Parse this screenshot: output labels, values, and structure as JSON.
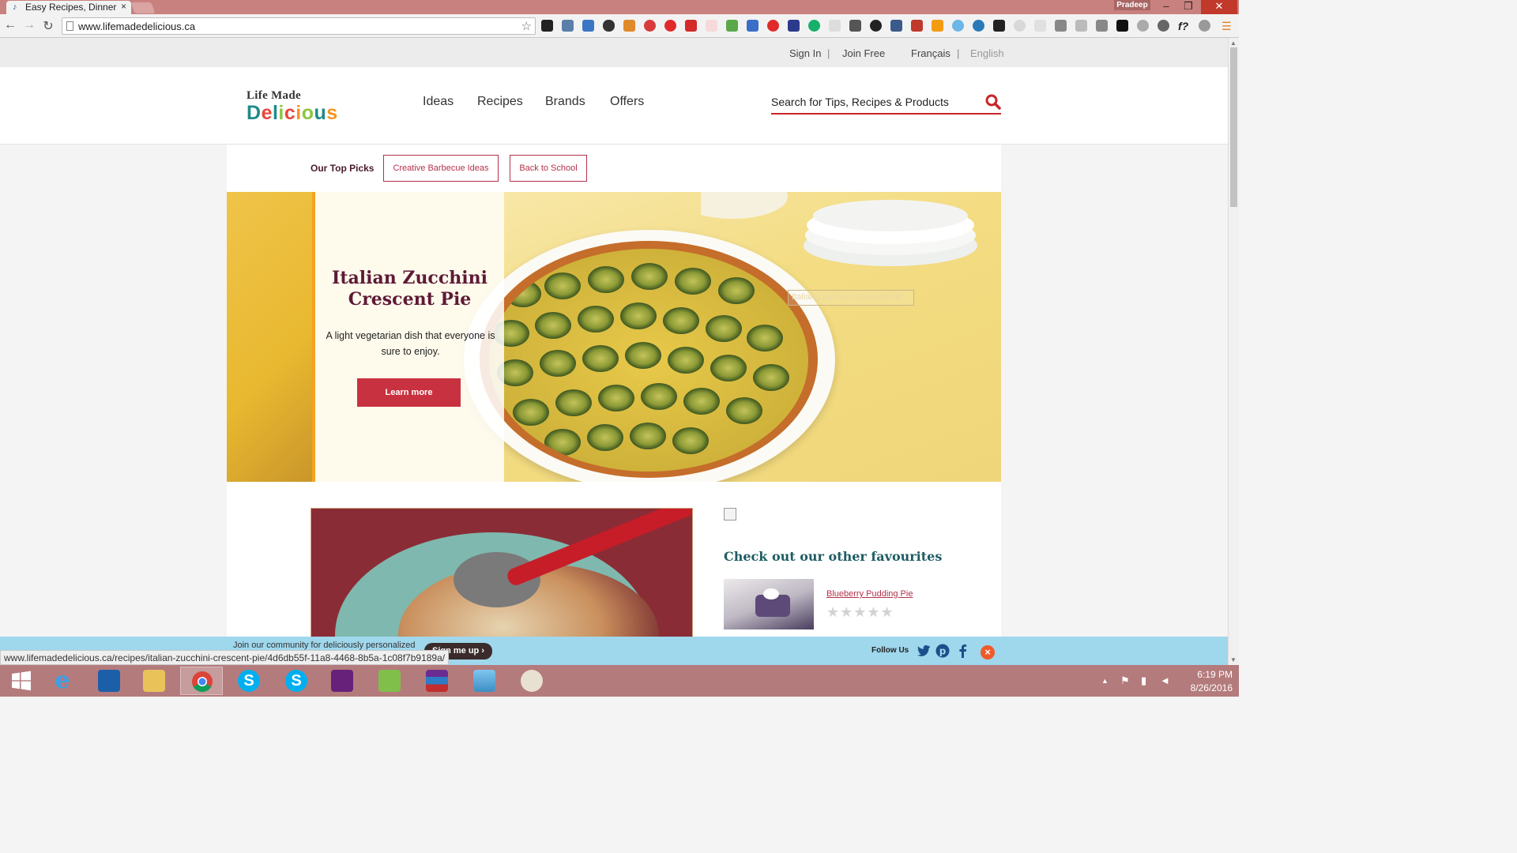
{
  "browser": {
    "tab_title": "Easy Recipes, Dinner",
    "tab_close": "×",
    "favicon": "♪",
    "profile_name": "Pradeep",
    "url": "www.lifemadedelicious.ca",
    "status_url": "www.lifemadedelicious.ca/recipes/italian-zucchini-crescent-pie/4d6db55f-11a8-4468-8b5a-1c08f7b9189a/",
    "window_controls": [
      "–",
      "❐",
      "✕"
    ],
    "nav_icons": [
      "←",
      "→",
      "↻"
    ]
  },
  "utility": {
    "sign_in": "Sign In",
    "sep": "|",
    "join_free": "Join Free",
    "lang_fr": "Français",
    "lang_en": "English"
  },
  "header": {
    "logo_top": "Life Made",
    "logo_word": "Delicious",
    "nav": [
      "Ideas",
      "Recipes",
      "Brands",
      "Offers"
    ],
    "search_placeholder": "Search for Tips, Recipes & Products"
  },
  "top_picks": {
    "label": "Our Top Picks",
    "buttons": [
      "Creative Barbecue Ideas",
      "Back to School"
    ]
  },
  "hero": {
    "title": "Italian Zucchini Crescent Pie",
    "description": "A light vegetarian dish that everyone is sure to enjoy.",
    "cta": "Learn more",
    "alt_text": "Italian Zucchini Crescent Pie"
  },
  "favourites": {
    "title": "Check out our other favourites",
    "items": [
      {
        "name": "Blueberry Pudding Pie",
        "rating": 0,
        "max_rating": 5
      }
    ],
    "star_glyphs": "★★★★★"
  },
  "banner": {
    "join_text": "Join our community for deliciously personalized",
    "signup": "Sign me up",
    "follow_label": "Follow Us",
    "close": "×"
  },
  "taskbar": {
    "time": "6:19 PM",
    "date": "8/26/2016",
    "tray_arrow": "▲"
  },
  "colors": {
    "brand_red": "#c8313f",
    "title_plum": "#5e1a36",
    "teal": "#1f5d63",
    "banner_blue": "#9fd7ec",
    "taskbar": "#b47b7c"
  }
}
